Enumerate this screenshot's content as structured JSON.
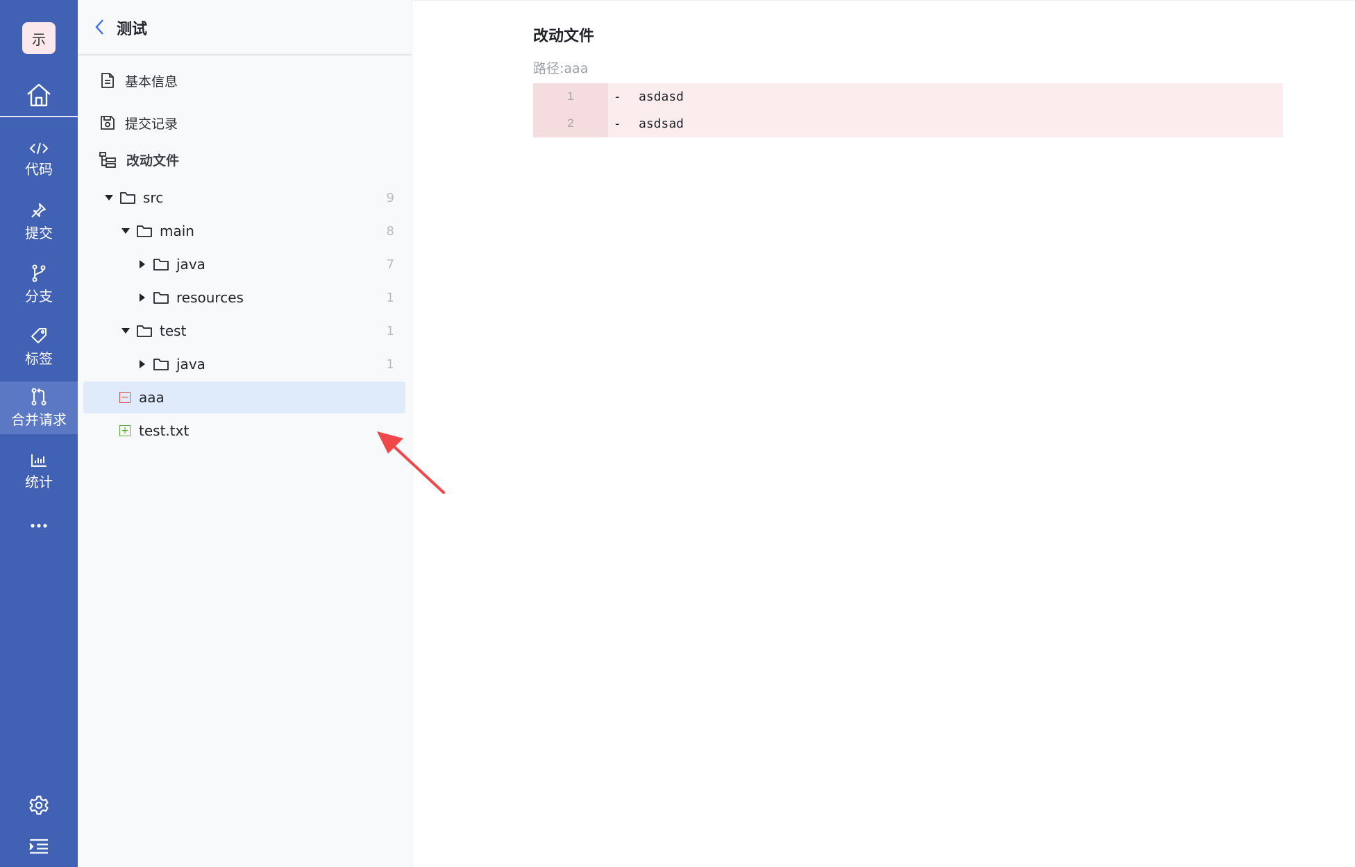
{
  "rail": {
    "logo_text": "示",
    "items": [
      {
        "label": "代码",
        "icon": "code-icon"
      },
      {
        "label": "提交",
        "icon": "pin-icon"
      },
      {
        "label": "分支",
        "icon": "branch-icon"
      },
      {
        "label": "标签",
        "icon": "tag-icon"
      },
      {
        "label": "合并请求",
        "icon": "merge-request-icon",
        "active": true
      },
      {
        "label": "统计",
        "icon": "bar-chart-icon"
      }
    ],
    "more_icon": "more-icon",
    "settings_icon": "gear-icon",
    "collapse_icon": "indent-icon",
    "accent": "#4161b4"
  },
  "panel": {
    "title": "测试",
    "menu": [
      {
        "label": "基本信息",
        "icon": "document-icon"
      },
      {
        "label": "提交记录",
        "icon": "save-icon"
      },
      {
        "label": "改动文件",
        "icon": "tree-list-icon",
        "current": true
      }
    ],
    "tree": [
      {
        "name": "src",
        "type": "folder",
        "expanded": true,
        "depth": 0,
        "count": "9"
      },
      {
        "name": "main",
        "type": "folder",
        "expanded": true,
        "depth": 1,
        "count": "8"
      },
      {
        "name": "java",
        "type": "folder",
        "expanded": false,
        "depth": 2,
        "count": "7"
      },
      {
        "name": "resources",
        "type": "folder",
        "expanded": false,
        "depth": 2,
        "count": "1"
      },
      {
        "name": "test",
        "type": "folder",
        "expanded": true,
        "depth": 1,
        "count": "1"
      },
      {
        "name": "java",
        "type": "folder",
        "expanded": false,
        "depth": 2,
        "count": "1"
      },
      {
        "name": "aaa",
        "type": "file-deleted",
        "depth": 1,
        "selected": true
      },
      {
        "name": "test.txt",
        "type": "file-added",
        "depth": 1
      }
    ]
  },
  "main": {
    "title": "改动文件",
    "path": "路径:aaa",
    "diff": [
      {
        "num": "1",
        "sign": "-",
        "text": "asdasd"
      },
      {
        "num": "2",
        "sign": "-",
        "text": "asdsad"
      }
    ],
    "removed_bg": "#fbecee",
    "selected_bg": "#dfeafb"
  }
}
